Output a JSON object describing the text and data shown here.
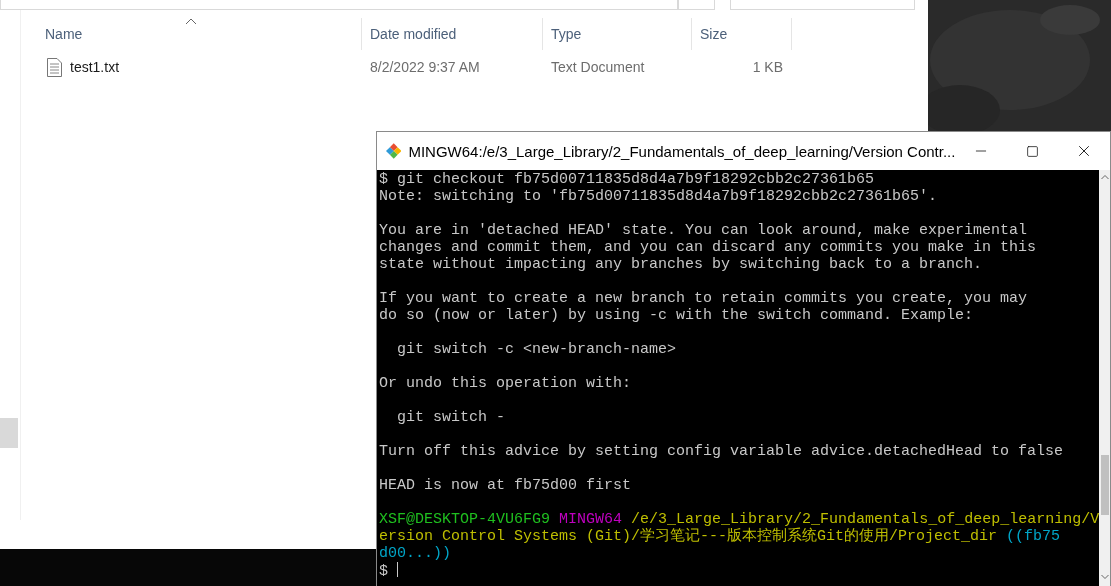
{
  "explorer": {
    "columns": [
      {
        "label": "Name",
        "sorted": true
      },
      {
        "label": "Date modified",
        "sorted": false
      },
      {
        "label": "Type",
        "sorted": false
      },
      {
        "label": "Size",
        "sorted": false
      }
    ],
    "files": [
      {
        "name": "test1.txt",
        "date_modified": "8/2/2022 9:37 AM",
        "type": "Text Document",
        "size": "1 KB"
      }
    ]
  },
  "terminal": {
    "title": "MINGW64:/e/3_Large_Library/2_Fundamentals_of_deep_learning/Version Contr...",
    "lines": [
      {
        "kind": "text",
        "segments": [
          {
            "kind": "plain",
            "text": "$ git checkout fb75d00711835d8d4a7b9f18292cbb2c27361b65"
          }
        ]
      },
      {
        "kind": "text",
        "segments": [
          {
            "kind": "plain",
            "text": "Note: switching to 'fb75d00711835d8d4a7b9f18292cbb2c27361b65'."
          }
        ]
      },
      {
        "kind": "blank"
      },
      {
        "kind": "text",
        "segments": [
          {
            "kind": "plain",
            "text": "You are in 'detached HEAD' state. You can look around, make experimental"
          }
        ]
      },
      {
        "kind": "text",
        "segments": [
          {
            "kind": "plain",
            "text": "changes and commit them, and you can discard any commits you make in this"
          }
        ]
      },
      {
        "kind": "text",
        "segments": [
          {
            "kind": "plain",
            "text": "state without impacting any branches by switching back to a branch."
          }
        ]
      },
      {
        "kind": "blank"
      },
      {
        "kind": "text",
        "segments": [
          {
            "kind": "plain",
            "text": "If you want to create a new branch to retain commits you create, you may"
          }
        ]
      },
      {
        "kind": "text",
        "segments": [
          {
            "kind": "plain",
            "text": "do so (now or later) by using -c with the switch command. Example:"
          }
        ]
      },
      {
        "kind": "blank"
      },
      {
        "kind": "text",
        "segments": [
          {
            "kind": "plain",
            "text": "  git switch -c <new-branch-name>"
          }
        ]
      },
      {
        "kind": "blank"
      },
      {
        "kind": "text",
        "segments": [
          {
            "kind": "plain",
            "text": "Or undo this operation with:"
          }
        ]
      },
      {
        "kind": "blank"
      },
      {
        "kind": "text",
        "segments": [
          {
            "kind": "plain",
            "text": "  git switch -"
          }
        ]
      },
      {
        "kind": "blank"
      },
      {
        "kind": "text",
        "segments": [
          {
            "kind": "plain",
            "text": "Turn off this advice by setting config variable advice.detachedHead to false"
          }
        ]
      },
      {
        "kind": "blank"
      },
      {
        "kind": "text",
        "segments": [
          {
            "kind": "plain",
            "text": "HEAD is now at fb75d00 first"
          }
        ]
      },
      {
        "kind": "blank"
      },
      {
        "kind": "text",
        "segments": [
          {
            "kind": "user",
            "text": "XSF@DESKTOP-4VU6FG9"
          },
          {
            "kind": "shell",
            "text": "MINGW64"
          },
          {
            "kind": "path",
            "text": "/e/3_Large_Library/2_Fundamentals_of_deep_learning/V"
          }
        ]
      },
      {
        "kind": "text",
        "segments": [
          {
            "kind": "path",
            "text": "ersion Control Systems (Git)/学习笔记---版本控制系统Git的使用/Project_dir"
          },
          {
            "kind": "branch",
            "text": "((fb75"
          }
        ]
      },
      {
        "kind": "text",
        "segments": [
          {
            "kind": "branch",
            "text": "d00...))"
          }
        ]
      },
      {
        "kind": "text",
        "cursor": true,
        "segments": [
          {
            "kind": "plain",
            "text": "$"
          }
        ]
      }
    ]
  }
}
